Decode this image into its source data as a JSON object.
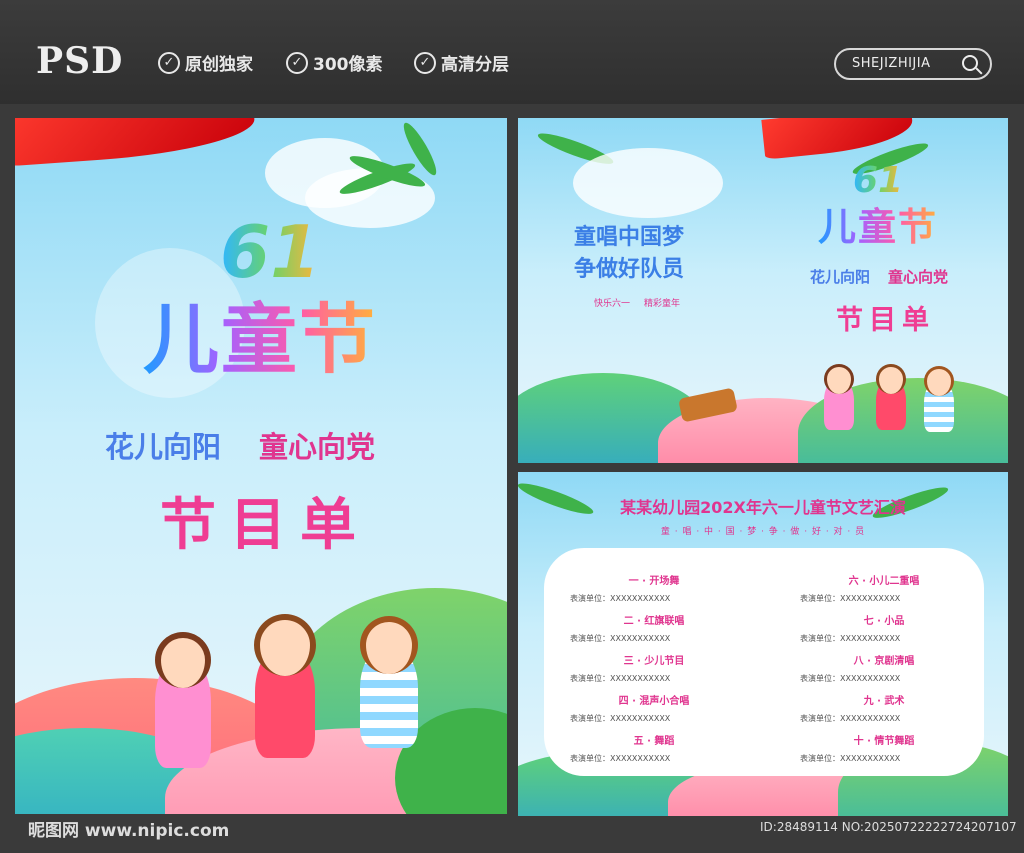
{
  "header": {
    "psd_label": "PSD",
    "badges": [
      "原创独家",
      "300像素",
      "高清分层"
    ],
    "search_text": "SHEJIZHIJIA"
  },
  "poster": {
    "logo_num": "61",
    "logo_title": "儿童节",
    "slogan_left": "花儿向阳",
    "slogan_right": "童心向党",
    "program_title": "节目单"
  },
  "cover": {
    "line1": "童唱中国梦",
    "line2": "争做好队员",
    "sub_left": "快乐六一",
    "sub_right": "精彩童年",
    "logo_num": "61",
    "logo_title": "儿童节",
    "slogan_left": "花儿向阳",
    "slogan_right": "童心向党",
    "program_title": "节目单"
  },
  "program_list": {
    "title": "某某幼儿园202X年六一儿童节文艺汇演",
    "subtitle": "童 · 唱 · 中 · 国 · 梦 · 争 · 做 · 好 · 对 · 员",
    "performer_label": "表演单位：XXXXXXXXXXX",
    "left": [
      "一 · 开场舞",
      "二 · 红旗联唱",
      "三 · 少儿节目",
      "四 · 混声小合唱",
      "五 · 舞蹈"
    ],
    "right": [
      "六 · 小儿二重唱",
      "七 · 小品",
      "八 · 京剧清唱",
      "九 · 武术",
      "十 · 情节舞蹈"
    ]
  },
  "footer": {
    "site": "昵图网 www.nipic.com",
    "id": "ID:28489114 NO:20250722222724207107"
  },
  "colors": {
    "accent_pink": "#ef3d93",
    "accent_blue": "#4a7ee8",
    "background": "#3a3a3a"
  }
}
